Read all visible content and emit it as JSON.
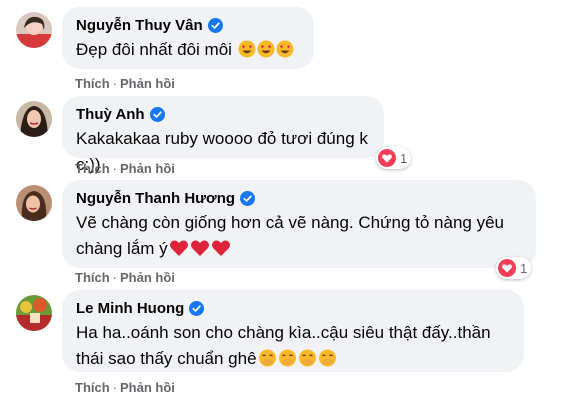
{
  "comments": [
    {
      "name": "Nguyễn Thuy Vân",
      "text": "Đẹp đôi nhất đôi môi",
      "emoji": "heart-eyes-emoji",
      "like": "Thích",
      "reply": "Phản hồi",
      "reaction_count": ""
    },
    {
      "name": "Thuỳ Anh",
      "text": "Kakakakaa ruby woooo đỏ tươi đúng k c:))",
      "like": "Thích",
      "reply": "Phản hồi",
      "reaction_count": "1"
    },
    {
      "name": "Nguyễn Thanh Hương",
      "text_line1": "Vẽ chàng còn giống hơn cả vẽ nàng. Chứng tỏ nàng yêu",
      "text_line2": "chàng lắm ý",
      "emoji": "red-heart-emoji",
      "like": "Thích",
      "reply": "Phản hồi",
      "reaction_count": "1"
    },
    {
      "name": "Le Minh Huong",
      "text_line1": "Ha ha..oánh son cho chàng kìa..cậu siêu thật đấy..thần",
      "text_line2": "thái sao thấy chuẩn ghê",
      "emoji": "laughing-hand-over-mouth-emoji",
      "like": "Thích",
      "reply": "Phản hồi",
      "reaction_count": ""
    }
  ],
  "colors": {
    "bubble": "#f0f2f5",
    "verified": "#1877f2",
    "action_text": "#65676b",
    "heart": "#f33e58"
  }
}
